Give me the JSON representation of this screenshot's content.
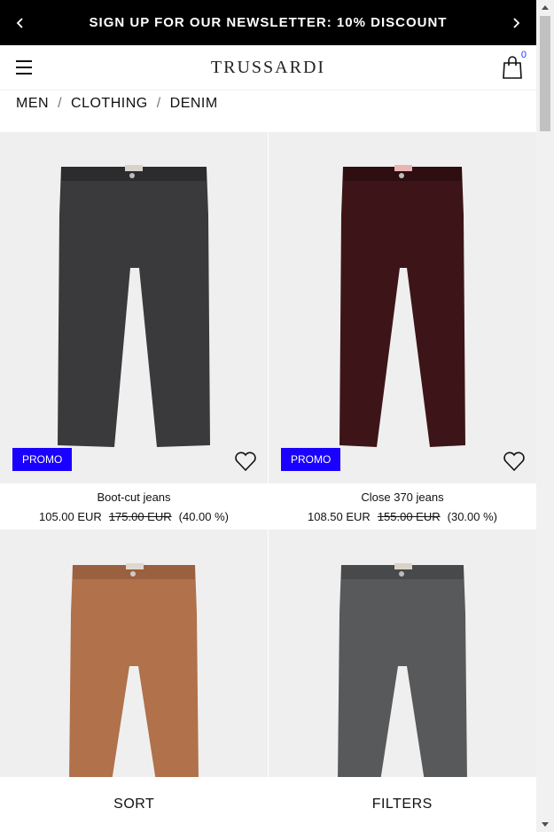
{
  "topbar": {
    "message": "SIGN UP FOR OUR NEWSLETTER: 10% DISCOUNT",
    "prev_icon": "chevron-left-icon",
    "next_icon": "chevron-right-icon"
  },
  "header": {
    "logo": "TRUSSARDI",
    "cart_count": "0",
    "menu_icon": "hamburger-icon",
    "cart_icon": "shopping-bag-icon"
  },
  "breadcrumb": {
    "items": [
      "MEN",
      "CLOTHING",
      "DENIM"
    ],
    "separator": "/"
  },
  "products": [
    {
      "name": "Boot-cut jeans",
      "price": "105.00 EUR",
      "old_price": "175.00 EUR",
      "discount": "(40.00 %)",
      "badge": "PROMO",
      "color": "#3a3a3c"
    },
    {
      "name": "Close 370 jeans",
      "price": "108.50 EUR",
      "old_price": "155.00 EUR",
      "discount": "(30.00 %)",
      "badge": "PROMO",
      "color": "#3d1518"
    },
    {
      "color": "#b0714b"
    },
    {
      "color": "#58595b"
    }
  ],
  "bottom_bar": {
    "sort_label": "SORT",
    "filters_label": "FILTERS"
  },
  "colors": {
    "accent": "#1a00ff",
    "topbar_bg": "#000000",
    "image_bg": "#efefef"
  }
}
